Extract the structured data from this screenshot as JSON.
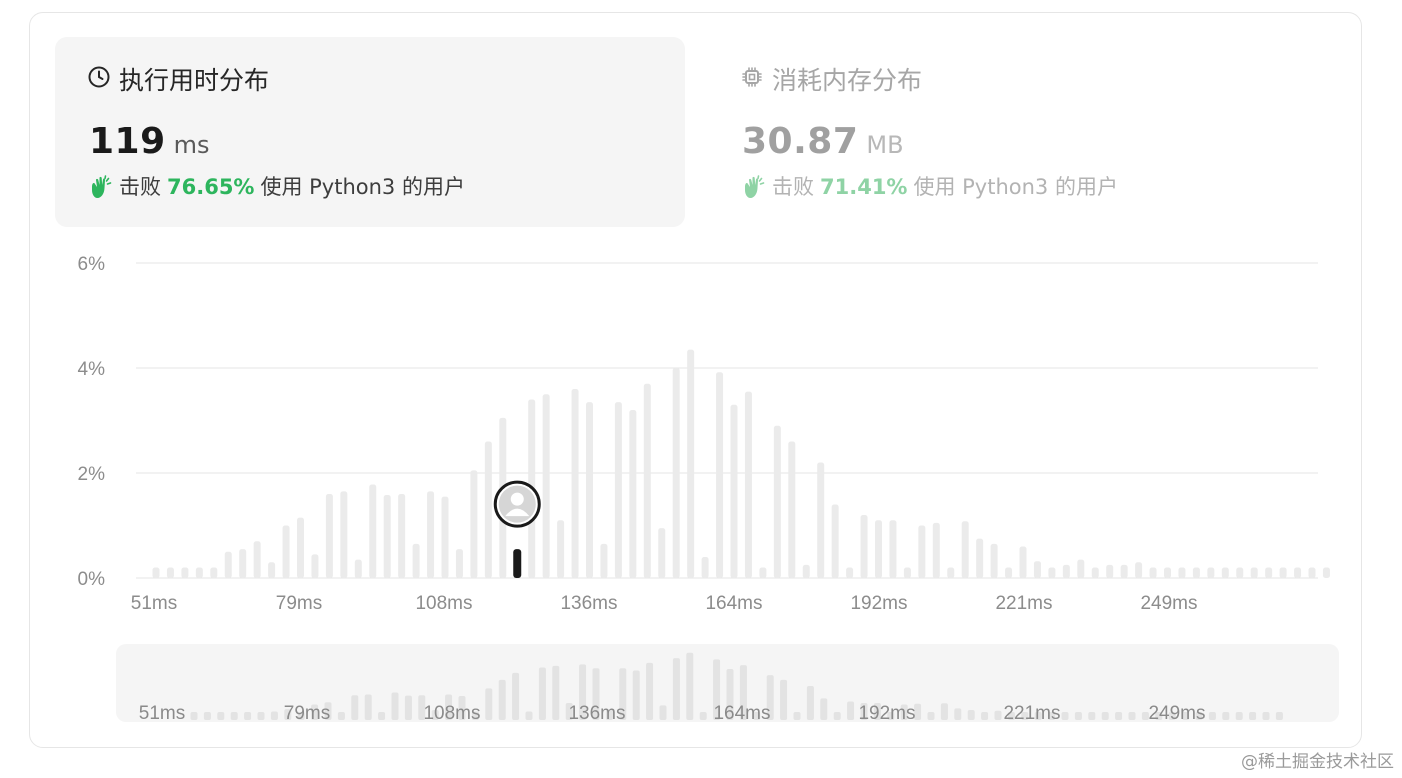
{
  "runtime_tab": {
    "title": "执行用时分布",
    "value": "119",
    "unit": "ms",
    "beats_prefix": "击败",
    "beats_pct": "76.65%",
    "beats_suffix": "使用 Python3 的用户",
    "icon": "clock-icon"
  },
  "memory_tab": {
    "title": "消耗内存分布",
    "value": "30.87",
    "unit": "MB",
    "beats_prefix": "击败",
    "beats_pct": "71.41%",
    "beats_suffix": "使用 Python3 的用户",
    "icon": "chip-icon"
  },
  "colors": {
    "bar": "#ebebeb",
    "highlight_bar": "#1a1a1a",
    "grid": "#e5e5e5",
    "tick_text": "#8c8c8c",
    "green": "#2db55d",
    "navigator_bg": "#f5f5f5",
    "navigator_bar": "#e3e3e3"
  },
  "watermark": "@稀土掘金技术社区",
  "chart_data": {
    "type": "bar",
    "x_tick_labels": [
      "51ms",
      "79ms",
      "108ms",
      "136ms",
      "164ms",
      "192ms",
      "221ms",
      "249ms"
    ],
    "y_tick_labels": [
      "0%",
      "2%",
      "4%",
      "6%"
    ],
    "ylim": [
      0,
      6
    ],
    "highlighted_bar": 25,
    "highlight_marker": "avatar-icon",
    "values": [
      0.2,
      0.2,
      0.2,
      0.2,
      0.2,
      0.5,
      0.55,
      0.7,
      0.3,
      1.0,
      1.15,
      0.45,
      1.6,
      1.65,
      0.35,
      1.78,
      1.58,
      1.6,
      0.65,
      1.65,
      1.55,
      0.55,
      2.05,
      2.6,
      3.05,
      0.55,
      3.4,
      3.5,
      1.1,
      3.6,
      3.35,
      0.65,
      3.35,
      3.2,
      3.7,
      0.95,
      4.0,
      4.35,
      0.4,
      3.92,
      3.3,
      3.55,
      0.2,
      2.9,
      2.6,
      0.25,
      2.2,
      1.4,
      0.2,
      1.2,
      1.1,
      1.1,
      0.2,
      1.0,
      1.05,
      0.2,
      1.08,
      0.75,
      0.65,
      0.2,
      0.6,
      0.32,
      0.2,
      0.25,
      0.35,
      0.2,
      0.25,
      0.25,
      0.3,
      0.2,
      0.2,
      0.2,
      0.2,
      0.2,
      0.2,
      0.2,
      0.2,
      0.2,
      0.2,
      0.2,
      0.2,
      0.2
    ]
  }
}
